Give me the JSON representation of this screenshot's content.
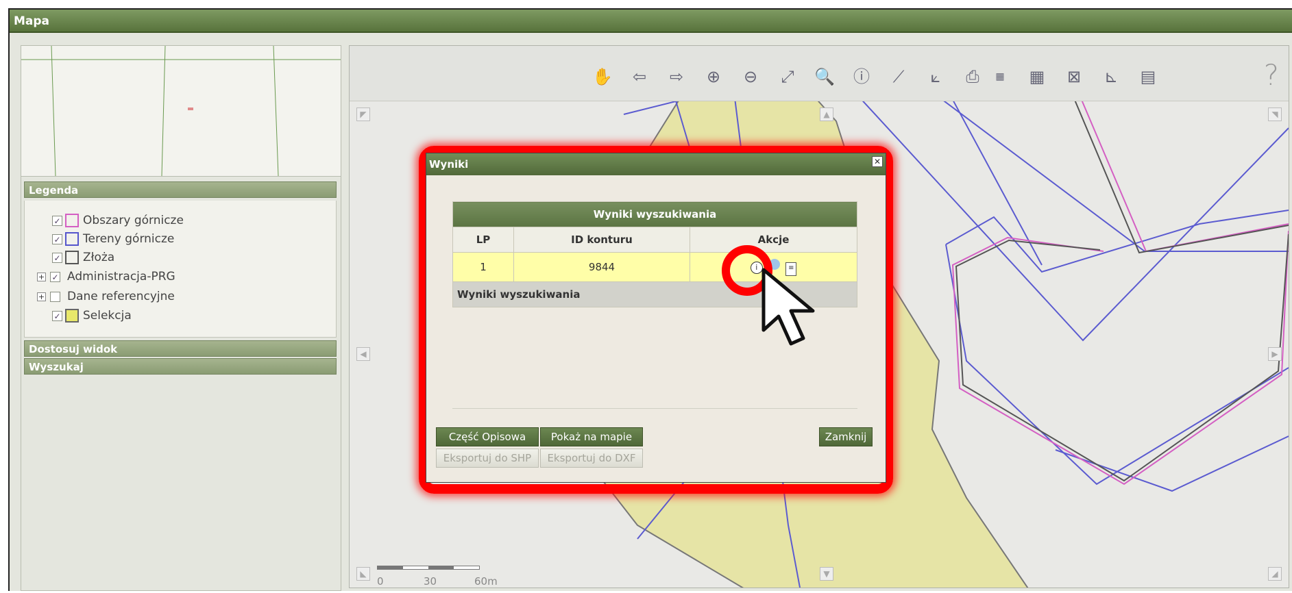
{
  "window": {
    "title": "Mapa"
  },
  "left_panel": {
    "legend_header": "Legenda",
    "legend_items": [
      {
        "label": "Obszary górnicze",
        "checked": true,
        "swatch_border": "#d45fc3",
        "swatch_fill": "#ffffff"
      },
      {
        "label": "Tereny górnicze",
        "checked": true,
        "swatch_border": "#5555cc",
        "swatch_fill": "#ffffff"
      },
      {
        "label": "Złoża",
        "checked": true,
        "swatch_border": "#555555",
        "swatch_fill": "#ffffff"
      },
      {
        "label": "Administracja-PRG",
        "checked": true,
        "expandable": true
      },
      {
        "label": "Dane referencyjne",
        "checked": false,
        "expandable": true
      },
      {
        "label": "Selekcja",
        "checked": true,
        "swatch_border": "#666666",
        "swatch_fill": "#e8e86a"
      }
    ],
    "customize_header": "Dostosuj widok",
    "search_header": "Wyszukaj"
  },
  "toolbar": {
    "tools": [
      "pan-icon",
      "back-icon",
      "forward-icon",
      "zoom-in-icon",
      "zoom-out-icon",
      "zoom-extent-icon",
      "zoom-selection-icon",
      "info-icon",
      "measure-length-icon",
      "measure-area-icon",
      "print-icon",
      "scale-icon",
      "wms-icon",
      "clear-selection-icon",
      "coordinates-icon",
      "layers-icon"
    ],
    "help_glyph": "?"
  },
  "scalebar": {
    "ticks": [
      "0",
      "30",
      "60m"
    ]
  },
  "dialog": {
    "title": "Wyniki",
    "table_caption": "Wyniki wyszukiwania",
    "columns": [
      "LP",
      "ID konturu",
      "Akcje"
    ],
    "rows": [
      {
        "lp": "1",
        "id": "9844"
      }
    ],
    "footer": "Wyniki wyszukiwania",
    "buttons": {
      "descriptive": "Część Opisowa",
      "show_on_map": "Pokaż na mapie",
      "close": "Zamknij",
      "export_shp": "Eksportuj do SHP",
      "export_dxf": "Eksportuj do DXF"
    }
  },
  "colors": {
    "accent": "#5b7442",
    "highlight": "#ff0000",
    "selection": "#e8e8a0"
  }
}
